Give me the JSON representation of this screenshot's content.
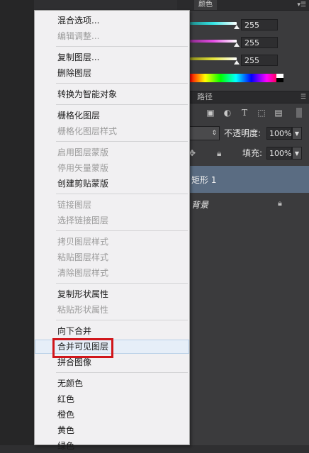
{
  "panel": {
    "color_tab": "颜色",
    "values": [
      "255",
      "255",
      "255"
    ],
    "paths_tab": "路径",
    "opacity_label": "不透明度:",
    "opacity_value": "100%",
    "fill_label": "填充:",
    "fill_value": "100%",
    "layers": [
      {
        "name": "矩形 1",
        "selected": true
      },
      {
        "name": "背景",
        "selected": false,
        "locked": true
      }
    ]
  },
  "menu": {
    "items": [
      {
        "label": "混合选项...",
        "disabled": false
      },
      {
        "label": "编辑调整...",
        "disabled": true
      },
      {
        "label": "复制图层...",
        "disabled": false
      },
      {
        "label": "删除图层",
        "disabled": false
      },
      {
        "label": "转换为智能对象",
        "disabled": false
      },
      {
        "label": "栅格化图层",
        "disabled": false
      },
      {
        "label": "栅格化图层样式",
        "disabled": true
      },
      {
        "label": "启用图层蒙版",
        "disabled": true
      },
      {
        "label": "停用矢量蒙版",
        "disabled": true
      },
      {
        "label": "创建剪贴蒙版",
        "disabled": false
      },
      {
        "label": "链接图层",
        "disabled": true
      },
      {
        "label": "选择链接图层",
        "disabled": true
      },
      {
        "label": "拷贝图层样式",
        "disabled": true
      },
      {
        "label": "粘贴图层样式",
        "disabled": true
      },
      {
        "label": "清除图层样式",
        "disabled": true
      },
      {
        "label": "复制形状属性",
        "disabled": false
      },
      {
        "label": "粘贴形状属性",
        "disabled": true
      },
      {
        "label": "向下合并",
        "disabled": false
      },
      {
        "label": "合并可见图层",
        "disabled": false,
        "highlighted": true
      },
      {
        "label": "拼合图像",
        "disabled": false
      },
      {
        "label": "无颜色",
        "disabled": false
      },
      {
        "label": "红色",
        "disabled": false
      },
      {
        "label": "橙色",
        "disabled": false
      },
      {
        "label": "黄色",
        "disabled": false
      },
      {
        "label": "绿色",
        "disabled": false
      }
    ]
  },
  "colors": {
    "highlight_border": "#d0161b",
    "selected_layer": "#5a6c82",
    "cyan_slider": "#35e6e6",
    "magenta_slider": "#e64de6",
    "yellow_slider": "#e6e63a"
  }
}
